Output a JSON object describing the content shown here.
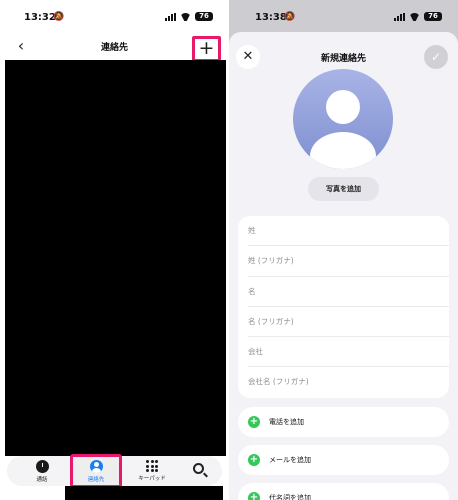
{
  "left": {
    "status": {
      "time": "13:32",
      "battery": "76"
    },
    "nav": {
      "back_glyph": "‹",
      "title": "連絡先",
      "add_glyph": "+"
    },
    "tabs": [
      {
        "label": "通話",
        "icon": "clock-icon"
      },
      {
        "label": "連絡先",
        "icon": "person-icon",
        "selected": true
      },
      {
        "label": "キーパッド",
        "icon": "keypad-icon"
      }
    ],
    "search_icon": "search-icon"
  },
  "right": {
    "status": {
      "time": "13:38",
      "battery": "76"
    },
    "sheet": {
      "close_glyph": "✕",
      "title": "新規連絡先",
      "done_glyph": "✓",
      "add_photo_label": "写真を追加",
      "fields": [
        "姓",
        "姓 (フリガナ)",
        "名",
        "名 (フリガナ)",
        "会社",
        "会社名 (フリガナ)"
      ],
      "actions": [
        "電話を追加",
        "メールを追加",
        "代名詞を追加"
      ],
      "action_icon_glyph": "+"
    }
  },
  "colors": {
    "highlight": "#e8196b",
    "accent_blue": "#1a7ff0",
    "add_green": "#34c759"
  }
}
